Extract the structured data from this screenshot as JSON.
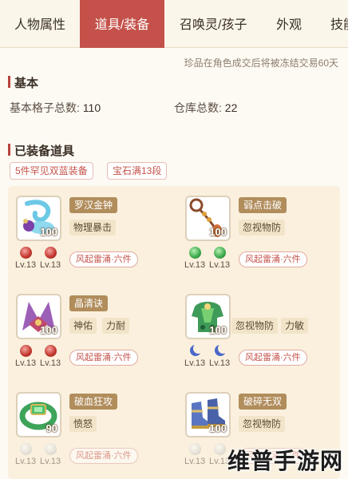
{
  "tabs": [
    {
      "label": "人物属性",
      "active": false
    },
    {
      "label": "道具/装备",
      "active": true
    },
    {
      "label": "召唤灵/孩子",
      "active": false
    },
    {
      "label": "外观",
      "active": false
    },
    {
      "label": "技能",
      "active": false
    }
  ],
  "notice": "珍品在角色成交后将被冻结交易60天",
  "basic": {
    "title": "基本",
    "grid_label": "基本格子总数:",
    "grid_value": "110",
    "storage_label": "仓库总数:",
    "storage_value": "22"
  },
  "equipped": {
    "title": "已装备道具",
    "chips": [
      "5件罕见双蓝装备",
      "宝石满13段"
    ]
  },
  "items": [
    {
      "name": "罗汉金钟",
      "tags": [
        "物理暴击"
      ],
      "level": "100",
      "gem_type": "red",
      "gems": [
        "Lv.13",
        "Lv.13"
      ],
      "set": "风起雷涌·六件",
      "icon": "bell-icon"
    },
    {
      "name": "弱点击破",
      "tags": [
        "忽视物防"
      ],
      "level": "100",
      "gem_type": "green",
      "gems": [
        "Lv.13",
        "Lv.13"
      ],
      "set": "风起雷涌·六件",
      "icon": "necklace-icon"
    },
    {
      "name": "晶清诀",
      "tags": [
        "神佑",
        "力耐"
      ],
      "level": "100",
      "gem_type": "red",
      "gems": [
        "Lv.13",
        "Lv.13"
      ],
      "set": "风起雷涌·六件",
      "icon": "fan-icon"
    },
    {
      "name": "",
      "tags": [
        "忽视物防",
        "力敏"
      ],
      "level": "100",
      "gem_type": "moon",
      "gems": [
        "Lv.13",
        "Lv.13"
      ],
      "set": "风起雷涌·六件",
      "icon": "armor-icon"
    },
    {
      "name": "破血狂攻",
      "tags": [
        "愤怒"
      ],
      "level": "90",
      "gem_type": "white",
      "gems": [
        "Lv.13",
        "Lv.13"
      ],
      "set": "风起雷涌·六件",
      "icon": "jade-belt-icon"
    },
    {
      "name": "破碎无双",
      "tags": [
        "忽视物防"
      ],
      "level": "100",
      "gem_type": "white",
      "gems": [
        "Lv.13",
        "Lv.13"
      ],
      "set": "风起雷涌·六件",
      "icon": "boots-icon"
    }
  ],
  "watermark": "维普手游网",
  "colors": {
    "accent": "#c4524a",
    "tab_active_bg": "#c4524a",
    "panel_bg": "#faf0dd",
    "name_badge": "#b18d5c"
  }
}
